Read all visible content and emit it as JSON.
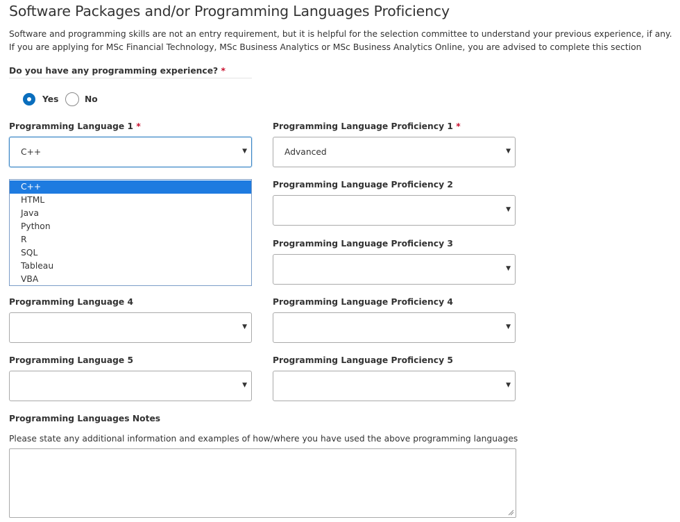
{
  "section": {
    "title": "Software Packages and/or Programming Languages Proficiency",
    "intro": "Software and programming skills are not an entry requirement, but it is helpful for the selection committee to understand your previous experience, if any. If you are applying for MSc Financial Technology, MSc Business Analytics or MSc Business Analytics Online, you are advised to complete this section"
  },
  "experience_question": {
    "label": "Do you have any programming experience?",
    "required_mark": "*",
    "options": [
      {
        "label": "Yes",
        "selected": true
      },
      {
        "label": "No",
        "selected": false
      }
    ]
  },
  "languages": [
    {
      "label": "Programming Language 1",
      "required_mark": "*",
      "value": "C++"
    },
    {
      "label": "Programming Language 4",
      "value": ""
    },
    {
      "label": "Programming Language 5",
      "value": ""
    }
  ],
  "proficiencies": [
    {
      "label": "Programming Language Proficiency 1",
      "required_mark": "*",
      "value": "Advanced"
    },
    {
      "label": "Programming Language Proficiency 2",
      "value": ""
    },
    {
      "label": "Programming Language Proficiency 3",
      "value": ""
    },
    {
      "label": "Programming Language Proficiency 4",
      "value": ""
    },
    {
      "label": "Programming Language Proficiency 5",
      "value": ""
    }
  ],
  "language1_dropdown": {
    "options": [
      "C++",
      "HTML",
      "Java",
      "Python",
      "R",
      "SQL",
      "Tableau",
      "VBA"
    ],
    "highlighted": "C++"
  },
  "notes": {
    "label": "Programming Languages Notes",
    "helper": "Please state any additional information and examples of how/where you have used the above programming languages",
    "value": ""
  },
  "colors": {
    "accent": "#0a6ebd",
    "required": "#c8102e",
    "highlight": "#1e7be0"
  }
}
